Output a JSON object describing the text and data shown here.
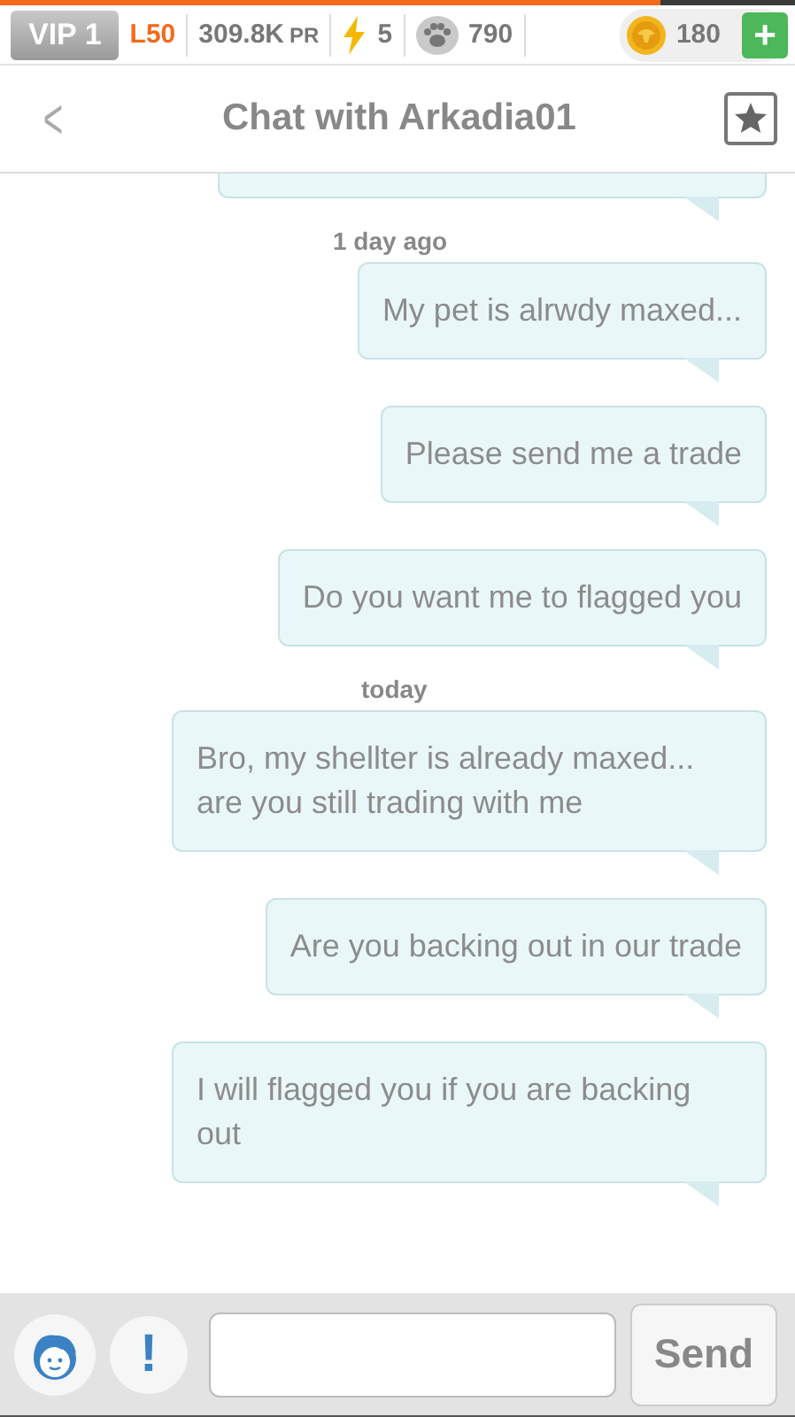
{
  "xp_bar": {
    "level": 0.83
  },
  "status_bar": {
    "vip": "VIP 1",
    "level_text": "L50",
    "pr_value": "309.8K",
    "pr_unit": "PR",
    "energy": "5",
    "paws": "790",
    "coins": "180",
    "add_button": "+"
  },
  "header": {
    "back": "<",
    "title": "Chat with Arkadia01"
  },
  "previous_message_visible": true,
  "messages": [
    {
      "kind": "time",
      "text": "1 day ago"
    },
    {
      "kind": "message",
      "text": "My pet is alrwdy maxed..."
    },
    {
      "kind": "message",
      "text": "Please send me a trade"
    },
    {
      "kind": "message",
      "text": "Do you want me to flagged you"
    },
    {
      "kind": "time",
      "text": "today"
    },
    {
      "kind": "message",
      "text": "Bro, my shellter is already maxed... are you still trading with me"
    },
    {
      "kind": "message",
      "text": "Are you backing out in our trade"
    },
    {
      "kind": "message",
      "text": "I will flagged you if you are backing out"
    }
  ],
  "composer": {
    "report": "!",
    "send": "Send"
  }
}
